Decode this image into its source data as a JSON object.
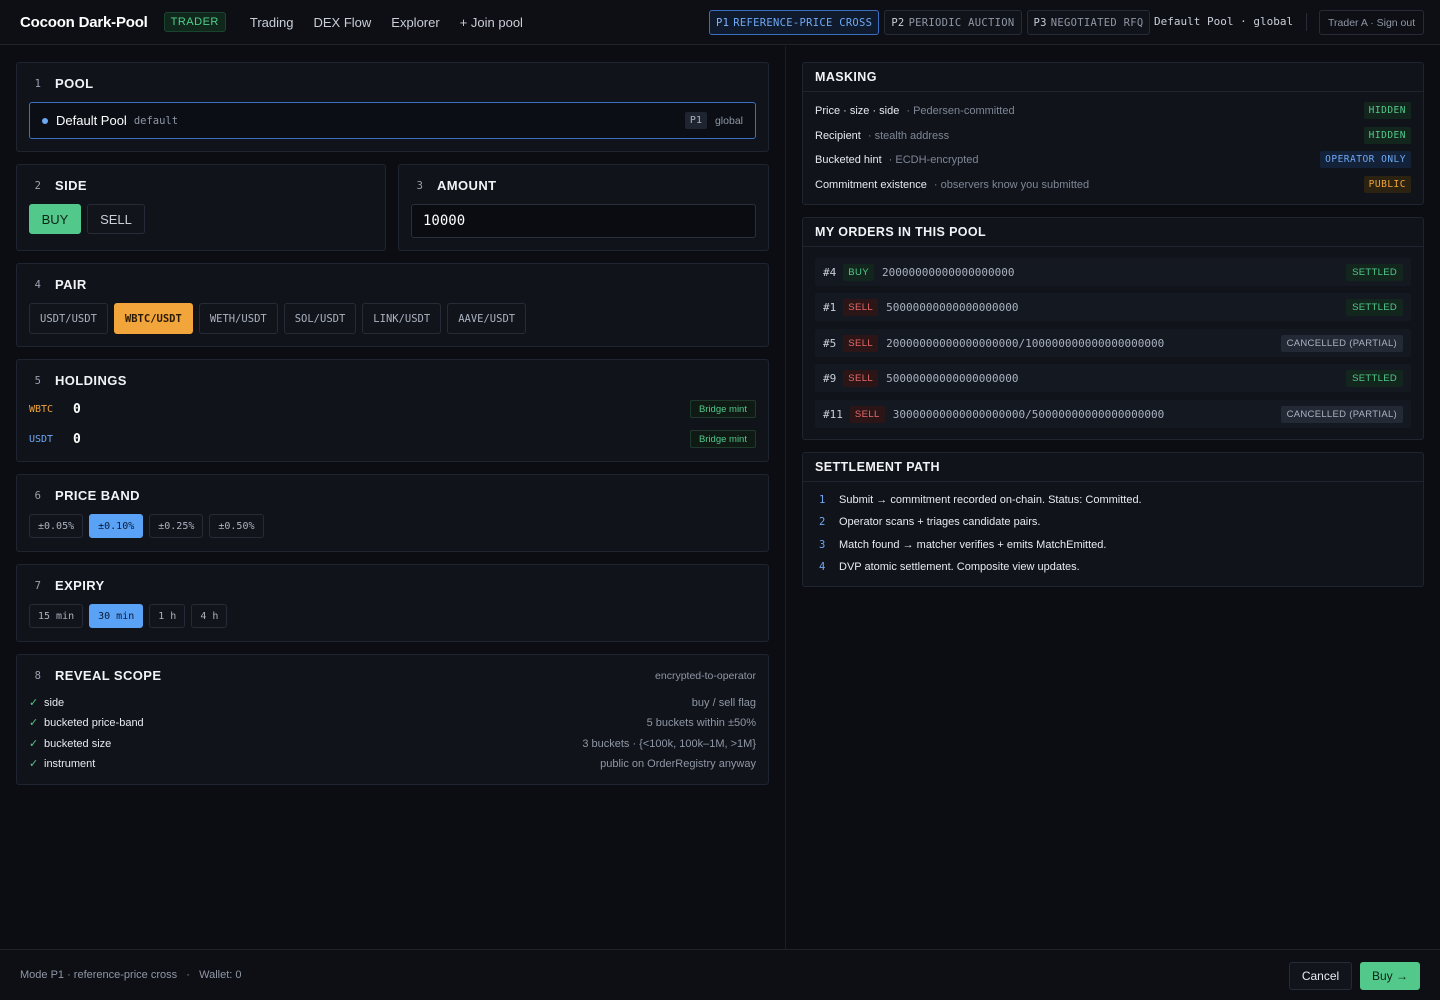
{
  "header": {
    "brand": "Cocoon Dark-Pool",
    "role": "TRADER",
    "nav": [
      "Trading",
      "DEX Flow",
      "Explorer",
      "+ Join pool"
    ],
    "modes": [
      {
        "code": "P1",
        "label": "REFERENCE-PRICE CROSS",
        "active": true
      },
      {
        "code": "P2",
        "label": "PERIODIC AUCTION",
        "active": false
      },
      {
        "code": "P3",
        "label": "NEGOTIATED RFQ",
        "active": false
      }
    ],
    "pool_label": "Default Pool · global",
    "user": "Trader A · Sign out"
  },
  "sections": {
    "pool": {
      "num": "1",
      "title": "POOL",
      "name": "Default Pool",
      "id": "default",
      "badge": "P1",
      "scope": "global"
    },
    "side": {
      "num": "2",
      "title": "SIDE",
      "buy": "BUY",
      "sell": "SELL",
      "selected": "BUY"
    },
    "amount": {
      "num": "3",
      "title": "AMOUNT",
      "value": "10000"
    },
    "pair": {
      "num": "4",
      "title": "PAIR",
      "options": [
        "USDT/USDT",
        "WBTC/USDT",
        "WETH/USDT",
        "SOL/USDT",
        "LINK/USDT",
        "AAVE/USDT"
      ],
      "selected": "WBTC/USDT"
    },
    "holdings": {
      "num": "5",
      "title": "HOLDINGS",
      "items": [
        {
          "token": "WBTC",
          "amount": "0",
          "action": "Bridge mint"
        },
        {
          "token": "USDT",
          "amount": "0",
          "action": "Bridge mint"
        }
      ]
    },
    "price_band": {
      "num": "6",
      "title": "PRICE BAND",
      "options": [
        "±0.05%",
        "±0.10%",
        "±0.25%",
        "±0.50%"
      ],
      "selected": "±0.10%"
    },
    "expiry": {
      "num": "7",
      "title": "EXPIRY",
      "options": [
        "15 min",
        "30 min",
        "1 h",
        "4 h"
      ],
      "selected": "30 min"
    },
    "reveal": {
      "num": "8",
      "title": "REVEAL SCOPE",
      "tag": "encrypted-to-operator",
      "items": [
        {
          "name": "side",
          "desc": "buy / sell flag"
        },
        {
          "name": "bucketed price-band",
          "desc": "5 buckets within ±50%"
        },
        {
          "name": "bucketed size",
          "desc": "3 buckets · {<100k, 100k–1M, >1M}"
        },
        {
          "name": "instrument",
          "desc": "public on OrderRegistry anyway"
        }
      ]
    }
  },
  "masking": {
    "title": "MASKING",
    "rows": [
      {
        "name": "Price · size · side",
        "desc": "· Pedersen-committed",
        "tag": "HIDDEN",
        "kind": "hidden"
      },
      {
        "name": "Recipient",
        "desc": "· stealth address",
        "tag": "HIDDEN",
        "kind": "hidden"
      },
      {
        "name": "Bucketed hint",
        "desc": "· ECDH-encrypted",
        "tag": "OPERATOR ONLY",
        "kind": "operator"
      },
      {
        "name": "Commitment existence",
        "desc": "· observers know you submitted",
        "tag": "PUBLIC",
        "kind": "public"
      }
    ]
  },
  "orders": {
    "title": "MY ORDERS IN THIS POOL",
    "rows": [
      {
        "id": "#4",
        "side": "BUY",
        "amount": "20000000000000000000",
        "status": "SETTLED"
      },
      {
        "id": "#1",
        "side": "SELL",
        "amount": "50000000000000000000",
        "status": "SETTLED"
      },
      {
        "id": "#5",
        "side": "SELL",
        "amount": "20000000000000000000/100000000000000000000",
        "status": "CANCELLED (PARTIAL)"
      },
      {
        "id": "#9",
        "side": "SELL",
        "amount": "50000000000000000000",
        "status": "SETTLED"
      },
      {
        "id": "#11",
        "side": "SELL",
        "amount": "30000000000000000000/50000000000000000000",
        "status": "CANCELLED (PARTIAL)"
      }
    ]
  },
  "settlement": {
    "title": "SETTLEMENT PATH",
    "steps": [
      "Submit → commitment recorded on-chain. Status: Committed.",
      "Operator scans + triages candidate pairs.",
      "Match found → matcher verifies + emits MatchEmitted.",
      "DVP atomic settlement. Composite view updates."
    ]
  },
  "footer": {
    "status": "Mode P1 · reference-price cross   ·   Wallet: 0",
    "cancel": "Cancel",
    "submit": "Buy →"
  },
  "colors": {
    "accent_blue": "#6ea8f5",
    "accent_green": "#52c98a",
    "accent_orange": "#f2a53a",
    "sell_red": "#e86a6a"
  }
}
